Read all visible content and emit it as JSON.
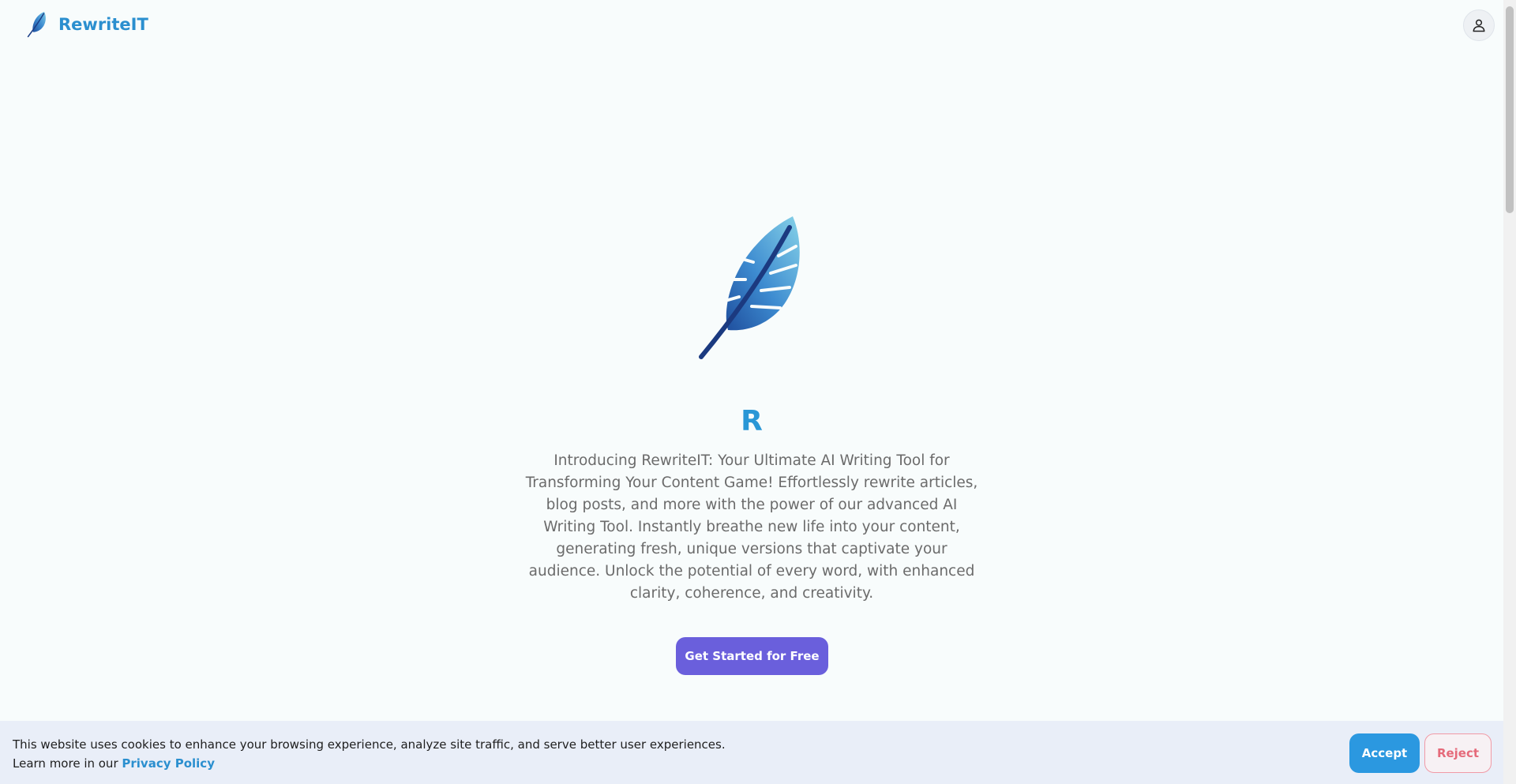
{
  "header": {
    "brand_name": "RewriteIT",
    "logo_icon": "feather-icon",
    "user_icon": "user-icon"
  },
  "hero": {
    "logo_icon": "feather-icon",
    "title": "R",
    "description": "Introducing RewriteIT: Your Ultimate AI Writing Tool for Transforming Your Content Game! Effortlessly rewrite articles, blog posts, and more with the power of our advanced AI Writing Tool. Instantly breathe new life into your content, generating fresh, unique versions that captivate your audience. Unlock the potential of every word, with enhanced clarity, coherence, and creativity.",
    "cta_label": "Get Started for Free"
  },
  "cookie_banner": {
    "message": "This website uses cookies to enhance your browsing experience, analyze site traffic, and serve better user experiences.",
    "learn_more_prefix": "Learn more in our",
    "privacy_link": "Privacy Policy",
    "accept_label": "Accept",
    "reject_label": "Reject"
  },
  "colors": {
    "brand": "#2b8fcf",
    "title": "#2a97d6",
    "cta": "#6a5fdc",
    "accept": "#2b98e0",
    "reject": "#e56a7a",
    "banner_bg": "#e9eef8"
  }
}
